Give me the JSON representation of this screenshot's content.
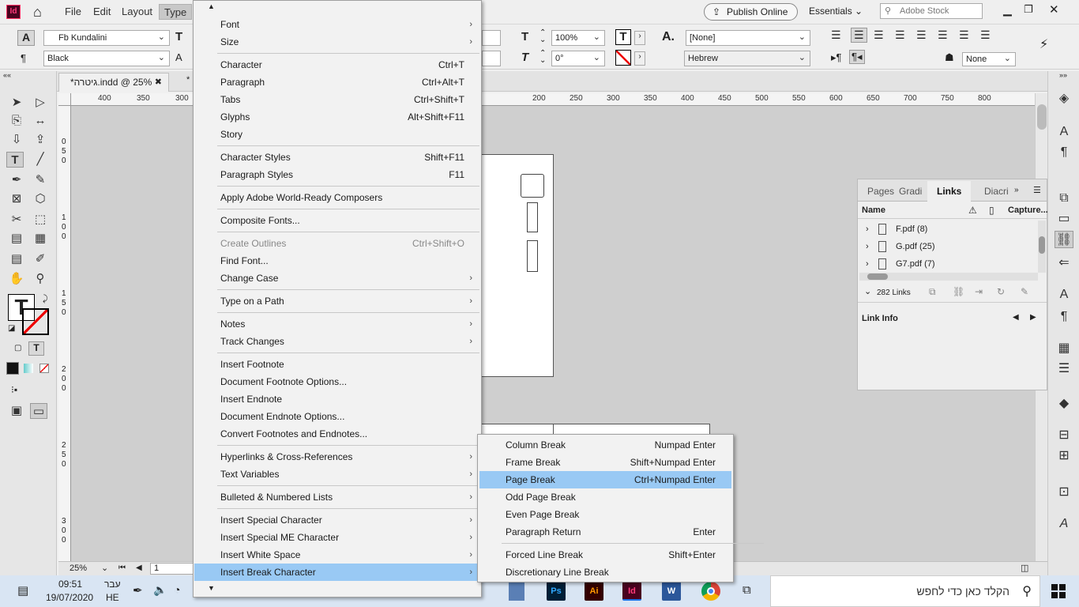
{
  "menubar": {
    "app_icon": "Id",
    "items": [
      "File",
      "Edit",
      "Layout",
      "Type"
    ],
    "publish_label": "Publish Online",
    "workspace": "Essentials",
    "stock_placeholder": "Adobe Stock"
  },
  "control": {
    "font_family": "Fb Kundalini",
    "font_style": "Black",
    "scale_h": "100%",
    "skew": "0°",
    "char_style": "[None]",
    "language": "Hebrew",
    "none_value": "None"
  },
  "document": {
    "tab_title": "*גיטרה.indd @ 25%",
    "zoom": "25%",
    "page": "1"
  },
  "ruler": {
    "h_ticks": [
      "400",
      "350",
      "300",
      "200",
      "250",
      "300",
      "350",
      "400",
      "450",
      "500",
      "550",
      "600",
      "650",
      "700",
      "750",
      "800"
    ],
    "v_ticks": [
      "0",
      "5",
      "0",
      "1",
      "0",
      "0",
      "1",
      "5",
      "0",
      "2",
      "0",
      "0",
      "2",
      "5",
      "0",
      "3",
      "0",
      "0"
    ]
  },
  "links_panel": {
    "tabs": [
      "Pages",
      "Gradi",
      "Links",
      "Diacri"
    ],
    "col_name": "Name",
    "col_caption": "Capture...",
    "rows": [
      "F.pdf (8)",
      "G.pdf (25)",
      "G7.pdf (7)"
    ],
    "count": "282 Links",
    "info_label": "Link Info"
  },
  "type_menu": [
    {
      "label": "Font",
      "arrow": true
    },
    {
      "label": "Size",
      "arrow": true
    },
    {
      "sep": true
    },
    {
      "label": "Character",
      "shortcut": "Ctrl+T"
    },
    {
      "label": "Paragraph",
      "shortcut": "Ctrl+Alt+T"
    },
    {
      "label": "Tabs",
      "shortcut": "Ctrl+Shift+T"
    },
    {
      "label": "Glyphs",
      "shortcut": "Alt+Shift+F11"
    },
    {
      "label": "Story"
    },
    {
      "sep": true
    },
    {
      "label": "Character Styles",
      "shortcut": "Shift+F11"
    },
    {
      "label": "Paragraph Styles",
      "shortcut": "F11"
    },
    {
      "sep": true
    },
    {
      "label": "Apply Adobe World-Ready Composers"
    },
    {
      "sep": true
    },
    {
      "label": "Composite Fonts..."
    },
    {
      "sep": true
    },
    {
      "label": "Create Outlines",
      "shortcut": "Ctrl+Shift+O",
      "disabled": true
    },
    {
      "label": "Find Font..."
    },
    {
      "label": "Change Case",
      "arrow": true
    },
    {
      "sep": true
    },
    {
      "label": "Type on a Path",
      "arrow": true
    },
    {
      "sep": true
    },
    {
      "label": "Notes",
      "arrow": true
    },
    {
      "label": "Track Changes",
      "arrow": true
    },
    {
      "sep": true
    },
    {
      "label": "Insert Footnote"
    },
    {
      "label": "Document Footnote Options..."
    },
    {
      "label": "Insert Endnote"
    },
    {
      "label": "Document Endnote Options..."
    },
    {
      "label": "Convert Footnotes and Endnotes..."
    },
    {
      "sep": true
    },
    {
      "label": "Hyperlinks & Cross-References",
      "arrow": true
    },
    {
      "label": "Text Variables",
      "arrow": true
    },
    {
      "sep": true
    },
    {
      "label": "Bulleted & Numbered Lists",
      "arrow": true
    },
    {
      "sep": true
    },
    {
      "label": "Insert Special Character",
      "arrow": true
    },
    {
      "label": "Insert Special ME Character",
      "arrow": true
    },
    {
      "label": "Insert White Space",
      "arrow": true
    },
    {
      "label": "Insert Break Character",
      "arrow": true,
      "highlighted": true
    }
  ],
  "break_submenu": [
    {
      "label": "Column Break",
      "shortcut": "Numpad Enter"
    },
    {
      "label": "Frame Break",
      "shortcut": "Shift+Numpad Enter"
    },
    {
      "label": "Page Break",
      "shortcut": "Ctrl+Numpad Enter",
      "highlighted": true
    },
    {
      "label": "Odd Page Break"
    },
    {
      "label": "Even Page Break"
    },
    {
      "label": "Paragraph Return",
      "shortcut": "Enter"
    },
    {
      "sep": true
    },
    {
      "label": "Forced Line Break",
      "shortcut": "Shift+Enter"
    },
    {
      "label": "Discretionary Line Break"
    }
  ],
  "taskbar": {
    "time": "09:51",
    "date": "19/07/2020",
    "lang_top": "עבר",
    "lang_bottom": "HE",
    "search_text": "הקלד כאן כדי לחפש",
    "apps": [
      "Ps",
      "Ai",
      "Id",
      "W"
    ]
  },
  "colors": {
    "menu_highlight": "#99c9f4",
    "indesign_brand": "#ff3a7a",
    "taskbar": "#d9e5f3"
  }
}
